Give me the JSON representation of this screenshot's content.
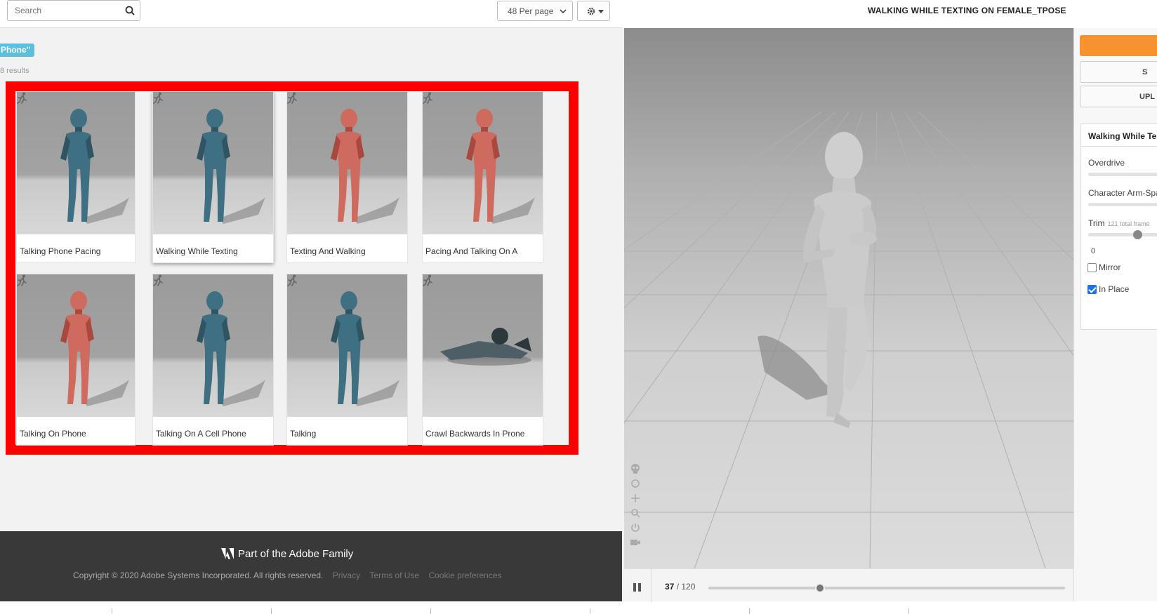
{
  "search": {
    "placeholder": "Search"
  },
  "toolbar": {
    "per_page": "48 Per page"
  },
  "filter": {
    "tag": "Phone\"",
    "results": "8 results"
  },
  "cards": [
    {
      "title": "Talking Phone Pacing",
      "figure": "teal"
    },
    {
      "title": "Walking While Texting",
      "figure": "teal"
    },
    {
      "title": "Texting And Walking",
      "figure": "red"
    },
    {
      "title": "Pacing And Talking On A",
      "figure": "red"
    },
    {
      "title": "Talking On Phone",
      "figure": "red"
    },
    {
      "title": "Talking On A Cell Phone",
      "figure": "teal"
    },
    {
      "title": "Talking",
      "figure": "teal"
    },
    {
      "title": "Crawl Backwards In Prone",
      "figure": "soldier"
    }
  ],
  "footer": {
    "tagline": "Part of the Adobe Family",
    "copyright": "Copyright © 2020 Adobe Systems Incorporated. All rights reserved.",
    "links": [
      "Privacy",
      "Terms of Use",
      "Cookie preferences"
    ]
  },
  "viewer": {
    "title": "WALKING WHILE TEXTING ON FEMALE_TPOSE",
    "frame_current": "37",
    "frame_total": "/ 120",
    "progress_fraction": 0.3
  },
  "side": {
    "buttons": [
      "",
      "S",
      "UPL"
    ],
    "panel_title": "Walking While Te",
    "overdrive_label": "Overdrive",
    "arm_label": "Character Arm-Spa",
    "trim_label": "Trim",
    "trim_note": "121 total frame",
    "trim_value": "0",
    "mirror_label": "Mirror",
    "inplace_label": "In Place"
  },
  "colors": {
    "accent": "#f7932e",
    "highlight": "#ff0000",
    "tag": "#5bc0de",
    "teal": "#3f6f82",
    "red": "#cf6a5e"
  }
}
